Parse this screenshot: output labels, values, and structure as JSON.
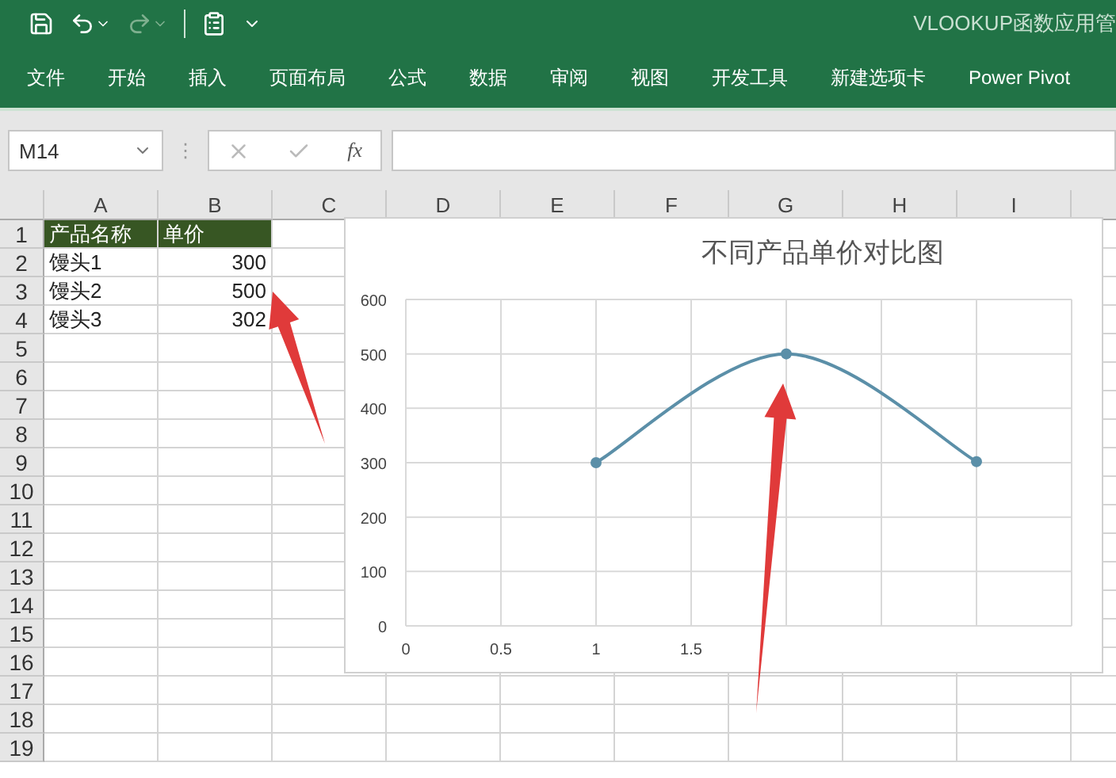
{
  "title_bar": {
    "title": "VLOOKUP函数应用管",
    "redo_disabled": true
  },
  "ribbon": {
    "tabs": [
      "文件",
      "开始",
      "插入",
      "页面布局",
      "公式",
      "数据",
      "审阅",
      "视图",
      "开发工具",
      "新建选项卡",
      "Power Pivot"
    ]
  },
  "formula_bar": {
    "name_box": "M14",
    "grip": "⋮",
    "function_label": "fx"
  },
  "sheet": {
    "columns": [
      "A",
      "B",
      "C",
      "D",
      "E",
      "F",
      "G",
      "H",
      "I"
    ],
    "row_numbers": [
      "1",
      "2",
      "3",
      "4",
      "5",
      "6",
      "7",
      "8",
      "9",
      "10",
      "11",
      "12",
      "13",
      "14",
      "15",
      "16",
      "17",
      "18",
      "19"
    ],
    "rows": [
      {
        "kind": "header",
        "cells": [
          "产品名称",
          "单价"
        ]
      },
      {
        "kind": "data",
        "cells": [
          "馒头1",
          "300"
        ]
      },
      {
        "kind": "data",
        "cells": [
          "馒头2",
          "500"
        ]
      },
      {
        "kind": "data",
        "cells": [
          "馒头3",
          "302"
        ]
      }
    ]
  },
  "chart": {
    "chart_data": {
      "type": "line",
      "title": "不同产品单价对比图",
      "x": [
        1,
        2,
        3
      ],
      "series": [
        {
          "color": "#5b8fa8",
          "marker": true,
          "values": [
            300,
            500,
            302
          ]
        }
      ],
      "grid": true,
      "xlim": [
        0,
        3.5
      ],
      "ylim": [
        0,
        600
      ],
      "xticks": [
        0,
        0.5,
        1,
        1.5
      ],
      "yticks": [
        0,
        100,
        200,
        300,
        400,
        500,
        600
      ]
    }
  }
}
